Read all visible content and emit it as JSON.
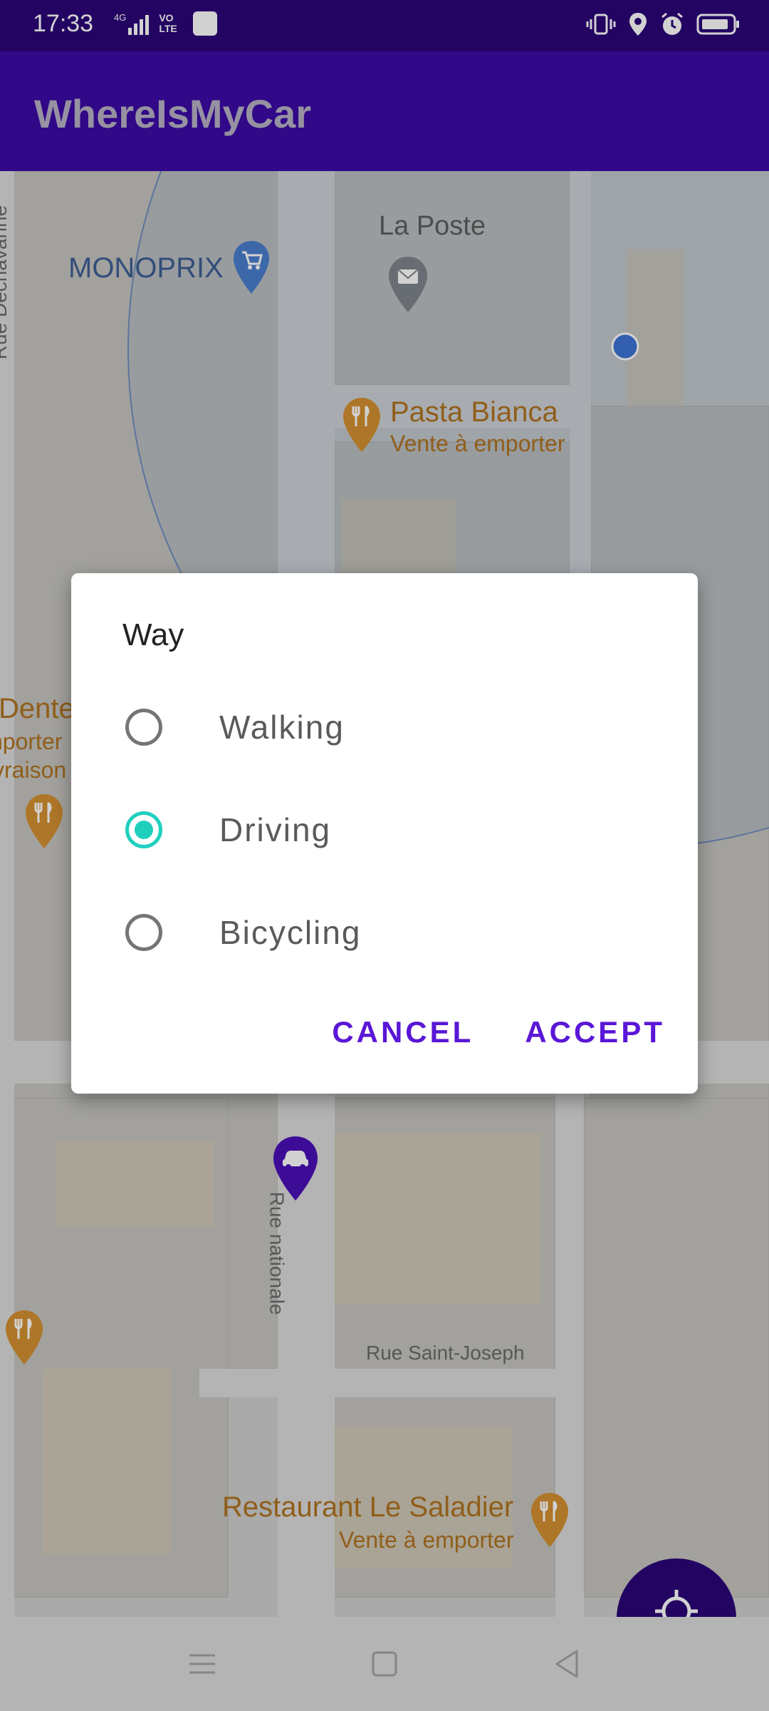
{
  "status_bar": {
    "time": "17:33",
    "network": "4G",
    "volte": "VO LTE",
    "icons": [
      "signal-icon",
      "layers-icon",
      "vibrate-icon",
      "location-icon",
      "alarm-icon",
      "battery-icon"
    ]
  },
  "app_bar": {
    "title": "WhereIsMyCar"
  },
  "map": {
    "labels": {
      "la_poste": "La Poste",
      "monoprix": "MONOPRIX",
      "pasta_name": "Pasta Bianca",
      "pasta_sub": "Vente à emporter",
      "rue_dechavanne": "Rue Dechavanne",
      "dente": "Dente",
      "porter": "nporter",
      "vraison": "vraison",
      "rue_nationale": "Rue nationale",
      "rue_saint_joseph": "Rue Saint-Joseph",
      "saladier_name": "Restaurant Le Saladier",
      "saladier_sub": "Vente à emporter"
    }
  },
  "dialog": {
    "title": "Way",
    "options": [
      {
        "label": "Walking",
        "selected": false
      },
      {
        "label": "Driving",
        "selected": true
      },
      {
        "label": "Bicycling",
        "selected": false
      }
    ],
    "cancel": "CANCEL",
    "accept": "ACCEPT"
  },
  "colors": {
    "primary": "#3b0aa6",
    "primary_dark": "#2b0678",
    "accent": "#1fcfbe",
    "button_text": "#5a16d6"
  }
}
